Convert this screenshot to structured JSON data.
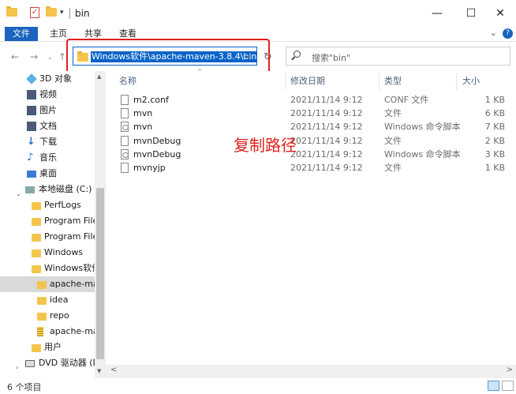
{
  "window": {
    "title": "bin",
    "quick_access_arrow": "▾",
    "minimize": "—",
    "maximize": "☐",
    "close": "✕"
  },
  "ribbon": {
    "tabs": [
      "文件",
      "主页",
      "共享",
      "查看"
    ],
    "collapse": "⌄",
    "help": "?"
  },
  "nav": {
    "address": "Windows软件\\apache-maven-3.8.4\\bin",
    "search_placeholder": "搜索\"bin\""
  },
  "sidebar": {
    "items": [
      {
        "label": "3D 对象",
        "icon": "3d-objects-icon"
      },
      {
        "label": "视频",
        "icon": "video-icon"
      },
      {
        "label": "图片",
        "icon": "pictures-icon"
      },
      {
        "label": "文档",
        "icon": "documents-icon"
      },
      {
        "label": "下载",
        "icon": "download-icon"
      },
      {
        "label": "音乐",
        "icon": "music-icon"
      },
      {
        "label": "桌面",
        "icon": "desktop-icon"
      },
      {
        "label": "本地磁盘 (C:)",
        "icon": "drive-icon"
      },
      {
        "label": "PerfLogs",
        "icon": "folder-icon"
      },
      {
        "label": "Program Files",
        "icon": "folder-icon"
      },
      {
        "label": "Program Files",
        "icon": "folder-icon"
      },
      {
        "label": "Windows",
        "icon": "folder-icon"
      },
      {
        "label": "Windows软件",
        "icon": "folder-icon"
      },
      {
        "label": "apache-mav",
        "icon": "folder-icon"
      },
      {
        "label": "idea",
        "icon": "folder-icon"
      },
      {
        "label": "repo",
        "icon": "folder-icon"
      },
      {
        "label": "apache-mav",
        "icon": "zip-icon"
      },
      {
        "label": "用户",
        "icon": "folder-icon"
      },
      {
        "label": "DVD 驱动器 (D:",
        "icon": "dvd-icon"
      }
    ]
  },
  "columns": {
    "name": "名称",
    "date": "修改日期",
    "type": "类型",
    "size": "大小"
  },
  "files": [
    {
      "name": "m2.conf",
      "date": "2021/11/14 9:12",
      "type": "CONF 文件",
      "size": "1 KB",
      "icon": "file-icon"
    },
    {
      "name": "mvn",
      "date": "2021/11/14 9:12",
      "type": "文件",
      "size": "6 KB",
      "icon": "file-icon"
    },
    {
      "name": "mvn",
      "date": "2021/11/14 9:12",
      "type": "Windows 命令脚本",
      "size": "7 KB",
      "icon": "script-icon"
    },
    {
      "name": "mvnDebug",
      "date": "2021/11/14 9:12",
      "type": "文件",
      "size": "2 KB",
      "icon": "file-icon"
    },
    {
      "name": "mvnDebug",
      "date": "2021/11/14 9:12",
      "type": "Windows 命令脚本",
      "size": "3 KB",
      "icon": "script-icon"
    },
    {
      "name": "mvnyjp",
      "date": "2021/11/14 9:12",
      "type": "文件",
      "size": "1 KB",
      "icon": "file-icon"
    }
  ],
  "annotation": "复制路径",
  "status": {
    "count": "6 个项目"
  }
}
